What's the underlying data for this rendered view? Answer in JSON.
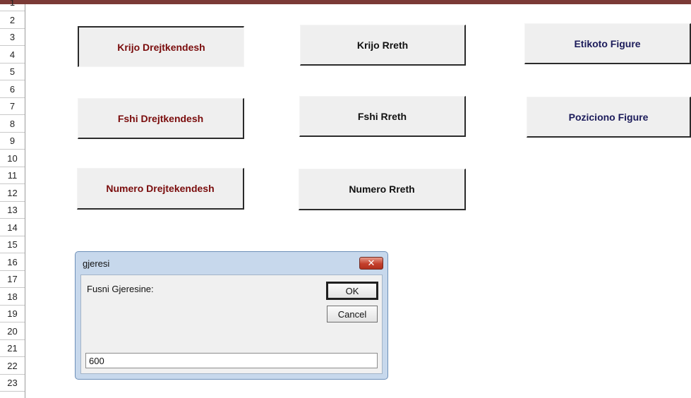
{
  "sheet": {
    "row_numbers": [
      "1",
      "2",
      "3",
      "4",
      "5",
      "6",
      "7",
      "8",
      "9",
      "10",
      "11",
      "12",
      "13",
      "14",
      "15",
      "16",
      "17",
      "18",
      "19",
      "20",
      "21",
      "22",
      "23"
    ]
  },
  "buttons": {
    "krijo_drejtkendesh": "Krijo Drejtkendesh",
    "krijo_rreth": "Krijo Rreth",
    "etikoto_figure": "Etikoto Figure",
    "fshi_drejtkendesh": "Fshi Drejtkendesh",
    "fshi_rreth": "Fshi Rreth",
    "poziciono_figure": "Poziciono Figure",
    "numero_drejtekendesh": "Numero Drejtekendesh",
    "numero_rreth": "Numero Rreth"
  },
  "dialog": {
    "title": "gjeresi",
    "close_label": "✕",
    "prompt": "Fusni Gjeresine:",
    "ok_label": "OK",
    "cancel_label": "Cancel",
    "input_value": "600"
  },
  "colors": {
    "title_bar": "#7b3a36",
    "rect_button_text": "#7a0c0c",
    "circle_button_text": "#111111",
    "figure_button_text": "#1b1b5a"
  }
}
